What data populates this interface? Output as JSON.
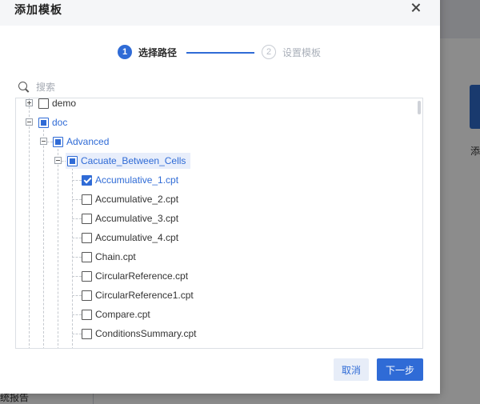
{
  "background": {
    "card_text": "添",
    "bottom_text": "统报告"
  },
  "dialog": {
    "title": "添加模板",
    "close_icon": "close-icon"
  },
  "steps": [
    {
      "number": "1",
      "label": "选择路径",
      "active": true
    },
    {
      "number": "2",
      "label": "设置模板",
      "active": false
    }
  ],
  "search": {
    "placeholder": "搜索",
    "value": ""
  },
  "tree": {
    "nodes": [
      {
        "label": "demo",
        "expanded": false,
        "state": "unchecked"
      },
      {
        "label": "doc",
        "expanded": true,
        "state": "partial"
      },
      {
        "label": "Advanced",
        "expanded": true,
        "state": "partial"
      },
      {
        "label": "Cacuate_Between_Cells",
        "expanded": true,
        "state": "partial",
        "selected": true
      },
      {
        "label": "Accumulative_1.cpt",
        "state": "checked"
      },
      {
        "label": "Accumulative_2.cpt",
        "state": "unchecked"
      },
      {
        "label": "Accumulative_3.cpt",
        "state": "unchecked"
      },
      {
        "label": "Accumulative_4.cpt",
        "state": "unchecked"
      },
      {
        "label": "Chain.cpt",
        "state": "unchecked"
      },
      {
        "label": "CircularReference.cpt",
        "state": "unchecked"
      },
      {
        "label": "CircularReference1.cpt",
        "state": "unchecked"
      },
      {
        "label": "Compare.cpt",
        "state": "unchecked"
      },
      {
        "label": "ConditionsSummary.cpt",
        "state": "unchecked"
      }
    ]
  },
  "footer": {
    "cancel_label": "取消",
    "next_label": "下一步"
  },
  "colors": {
    "accent": "#2f6bd6",
    "header_bg": "#f5f6f8"
  }
}
